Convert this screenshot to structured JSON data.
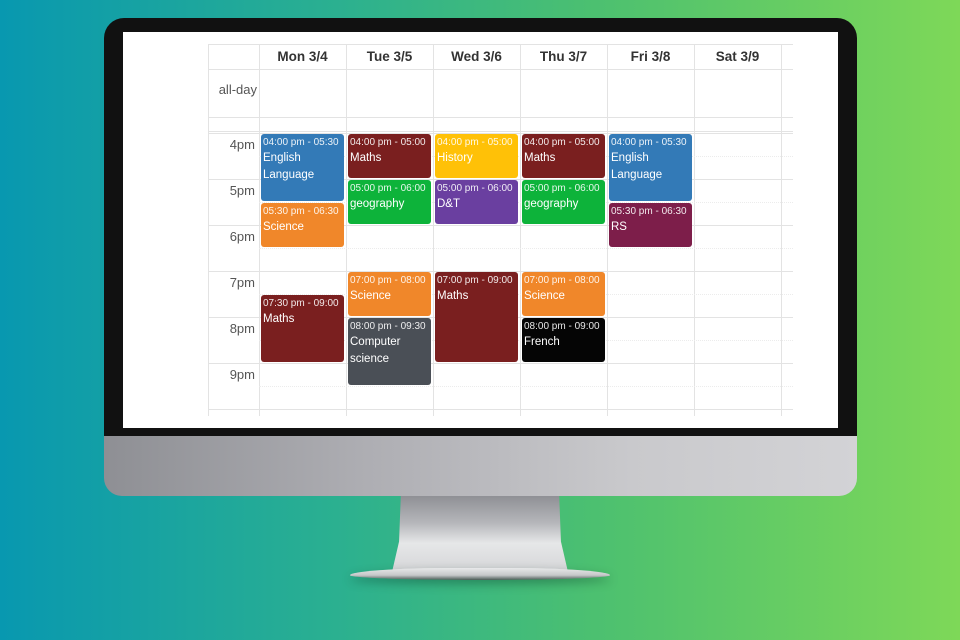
{
  "calendar": {
    "allday_label": "all-day",
    "days": [
      {
        "label": "Mon 3/4"
      },
      {
        "label": "Tue 3/5"
      },
      {
        "label": "Wed 3/6"
      },
      {
        "label": "Thu 3/7"
      },
      {
        "label": "Fri 3/8"
      },
      {
        "label": "Sat 3/9"
      }
    ],
    "time_labels": [
      "4pm",
      "5pm",
      "6pm",
      "7pm",
      "8pm",
      "9pm"
    ],
    "events": [
      {
        "day": 0,
        "start": 16.0,
        "end": 17.5,
        "time": "04:00 pm - 05:30",
        "title": "English Language",
        "color": "#337ab7"
      },
      {
        "day": 0,
        "start": 17.5,
        "end": 18.5,
        "time": "05:30 pm - 06:30",
        "title": "Science",
        "color": "#f0872a"
      },
      {
        "day": 0,
        "start": 19.5,
        "end": 21.0,
        "time": "07:30 pm - 09:00",
        "title": "Maths",
        "color": "#7a1f1f"
      },
      {
        "day": 1,
        "start": 16.0,
        "end": 17.0,
        "time": "04:00 pm - 05:00",
        "title": "Maths",
        "color": "#7a1f1f"
      },
      {
        "day": 1,
        "start": 17.0,
        "end": 18.0,
        "time": "05:00 pm - 06:00",
        "title": "geography",
        "color": "#0db33a"
      },
      {
        "day": 1,
        "start": 19.0,
        "end": 20.0,
        "time": "07:00 pm - 08:00",
        "title": "Science",
        "color": "#f0872a"
      },
      {
        "day": 1,
        "start": 20.0,
        "end": 21.5,
        "time": "08:00 pm - 09:30",
        "title": "Computer science",
        "color": "#4a4f56"
      },
      {
        "day": 2,
        "start": 16.0,
        "end": 17.0,
        "time": "04:00 pm - 05:00",
        "title": "History",
        "color": "#ffc107"
      },
      {
        "day": 2,
        "start": 17.0,
        "end": 18.0,
        "time": "05:00 pm - 06:00",
        "title": "D&T",
        "color": "#6a3fa0"
      },
      {
        "day": 2,
        "start": 19.0,
        "end": 21.0,
        "time": "07:00 pm - 09:00",
        "title": "Maths",
        "color": "#7a1f1f"
      },
      {
        "day": 3,
        "start": 16.0,
        "end": 17.0,
        "time": "04:00 pm - 05:00",
        "title": "Maths",
        "color": "#7a1f1f"
      },
      {
        "day": 3,
        "start": 17.0,
        "end": 18.0,
        "time": "05:00 pm - 06:00",
        "title": "geography",
        "color": "#0db33a"
      },
      {
        "day": 3,
        "start": 19.0,
        "end": 20.0,
        "time": "07:00 pm - 08:00",
        "title": "Science",
        "color": "#f0872a"
      },
      {
        "day": 3,
        "start": 20.0,
        "end": 21.0,
        "time": "08:00 pm - 09:00",
        "title": "French",
        "color": "#050505"
      },
      {
        "day": 4,
        "start": 16.0,
        "end": 17.5,
        "time": "04:00 pm - 05:30",
        "title": "English Language",
        "color": "#337ab7"
      },
      {
        "day": 4,
        "start": 17.5,
        "end": 18.5,
        "time": "05:30 pm - 06:30",
        "title": "RS",
        "color": "#7d1e4a"
      }
    ]
  }
}
